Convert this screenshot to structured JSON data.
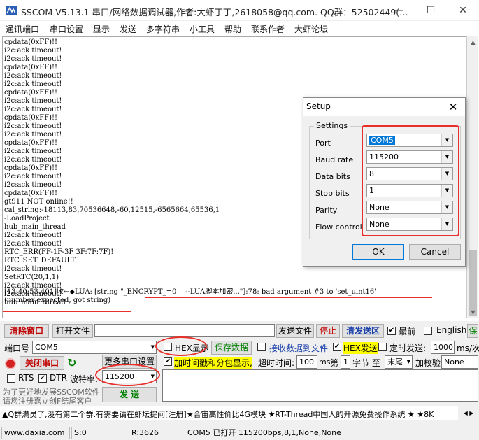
{
  "window": {
    "title": "SSCOM V5.13.1 串口/网络数据调试器,作者:大虾丁丁,2618058@qq.com. QQ群：52502449(…"
  },
  "menu": [
    "通讯端口",
    "串口设置",
    "显示",
    "发送",
    "多字符串",
    "小工具",
    "帮助",
    "联系作者",
    "大虾论坛"
  ],
  "log": {
    "lines": [
      "cpdata(0xFF)!!",
      "i2c:ack timeout!",
      "i2c:ack timeout!",
      "cpdata(0xFF)!!",
      "i2c:ack timeout!",
      "i2c:ack timeout!",
      "cpdata(0xFF)!!",
      "i2c:ack timeout!",
      "i2c:ack timeout!",
      "cpdata(0xFF)!!",
      "i2c:ack timeout!",
      "i2c:ack timeout!",
      "cpdata(0xFF)!!",
      "i2c:ack timeout!",
      "i2c:ack timeout!",
      "cpdata(0xFF)!!",
      "i2c:ack timeout!",
      "i2c:ack timeout!",
      "cpdata(0xFF)!!",
      "gt911 NOT online!!",
      "cal_string:-18113,83,70536648,-60,12515,-6565664,65536,1",
      "-LoadProject",
      "hub_main_thread",
      "i2c:ack timeout!",
      "i2c:ack timeout!",
      "RTC_ERR(FF-1F-3F 3F:7F:7F)!",
      "RTC_SET_DEFAULT",
      "i2c:ack timeout!",
      "SetRTC(20,1,1)",
      "i2c:ack timeout!",
      "i2c:ack timeout!",
      "hub_main_thread"
    ],
    "error_line1": "[13:40:53.401]收←◆LUA: [string \"_ENCRYPT_=0    --LUA脚本加密...\"]:78: bad argument #3 to 'set_uint16'",
    "error_line2": "(number expected, got string)"
  },
  "dialog": {
    "title": "Setup",
    "close": "✕",
    "group": "Settings",
    "fields": [
      {
        "label": "Port",
        "value": "COM5"
      },
      {
        "label": "Baud rate",
        "value": "115200"
      },
      {
        "label": "Data bits",
        "value": "8"
      },
      {
        "label": "Stop bits",
        "value": "1"
      },
      {
        "label": "Parity",
        "value": "None"
      },
      {
        "label": "Flow control",
        "value": "None"
      }
    ],
    "ok": "OK",
    "cancel": "Cancel"
  },
  "panel": {
    "clear_window": "清除窗口",
    "open_file": "打开文件",
    "send_file": "发送文件",
    "stop": "停止",
    "clear_send": "清发送区",
    "latest": "最前",
    "english": "English",
    "save_cut": "保",
    "port_label": "端口号",
    "port_value": "COM5",
    "hex_display": "HEX显示",
    "save_data": "保存数据",
    "recv_to_file": "接收数据到文件",
    "hex_send": "HEX发送",
    "timed_send": "定时发送:",
    "timed_ms": "1000",
    "ms_unit": "ms/次",
    "close_port": "关闭串口",
    "more_settings": "更多串口设置",
    "add_timestamp": "加时间戳和分包显示,",
    "timeout_label": "超时时间:",
    "timeout_value": "100",
    "ms": "ms",
    "byte_prefix": "第",
    "byte_value": "1",
    "byte_to": "字节 至",
    "tail": "末尾",
    "checksum_label": "加校验",
    "checksum_value": "None",
    "rts": "RTS",
    "dtr": "DTR",
    "baud_label": "波特率:",
    "baud_value": "115200",
    "ad_line1": "为了更好地发展SSCOM软件",
    "ad_line2": "请您注册嘉立创F结尾客户",
    "send": "发 送",
    "ticker": "▲Q群满员了,没有第二个群.有需要请在虾坛提问[注册]★合宙高性价比4G模块 ★RT-Thread中国人的开源免费操作系统 ★ ★8K"
  },
  "status": {
    "url": "www.daxia.com",
    "s": "S:0",
    "r": "R:3626",
    "port_state": "COM5 已打开  115200bps,8,1,None,None"
  }
}
